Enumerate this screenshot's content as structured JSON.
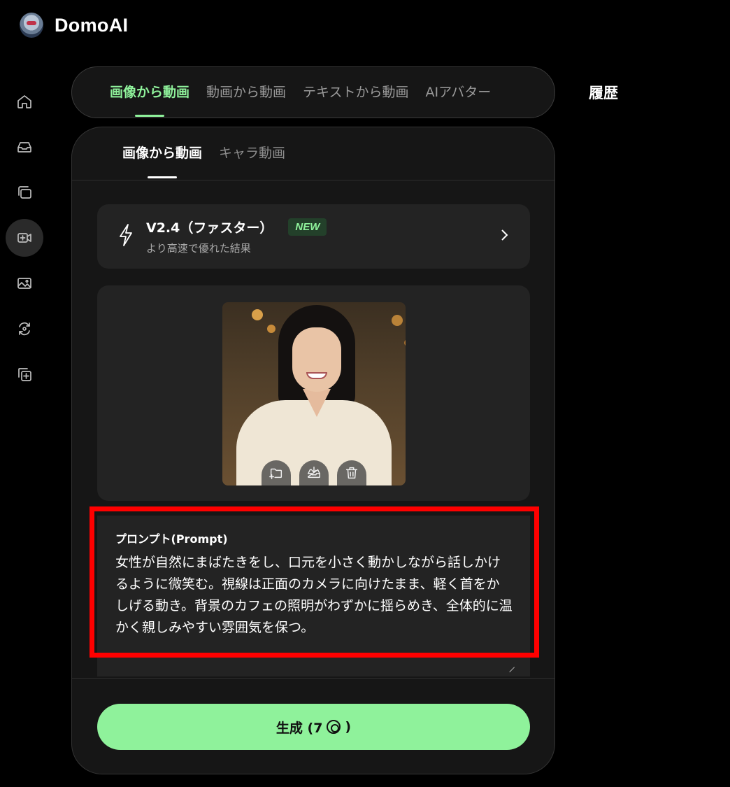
{
  "brand": {
    "name": "DomoAI",
    "logo_icon": "robot-avatar-icon"
  },
  "sidebar": {
    "items": [
      {
        "icon": "home-icon",
        "active": false
      },
      {
        "icon": "inbox-icon",
        "active": false
      },
      {
        "icon": "layers-icon",
        "active": false
      },
      {
        "icon": "video-plus-icon",
        "active": true
      },
      {
        "icon": "image-icon",
        "active": false
      },
      {
        "icon": "refresh-face-icon",
        "active": false
      },
      {
        "icon": "add-copy-icon",
        "active": false
      }
    ]
  },
  "top_tabs": {
    "items": [
      "画像から動画",
      "動画から動画",
      "テキストから動画",
      "AIアバター"
    ],
    "active": "画像から動画"
  },
  "history_label": "履歴",
  "sub_tabs": {
    "items": [
      "画像から動画",
      "キャラ動画"
    ],
    "active": "画像から動画"
  },
  "model": {
    "icon": "lightning-icon",
    "title": "V2.4（ファスター）",
    "badge": "NEW",
    "description": "より高速で優れた結果"
  },
  "image_tools": [
    "folder-add-icon",
    "inbox-download-icon",
    "trash-icon"
  ],
  "prompt": {
    "label": "プロンプト(Prompt)",
    "text": "女性が自然にまばたきをし、口元を小さく動かしながら話しかけるように微笑む。視線は正面のカメラに向けたまま、軽く首をかしげる動き。背景のカフェの照明がわずかに揺らめき、全体的に温かく親しみやすい雰囲気を保つ。"
  },
  "generate": {
    "label": "生成 (7",
    "suffix": ")",
    "coin_icon": "credit-coin-icon"
  },
  "colors": {
    "accent": "#8ff29b",
    "highlight": "#ff0000",
    "panel": "#161616",
    "card": "#232323"
  }
}
